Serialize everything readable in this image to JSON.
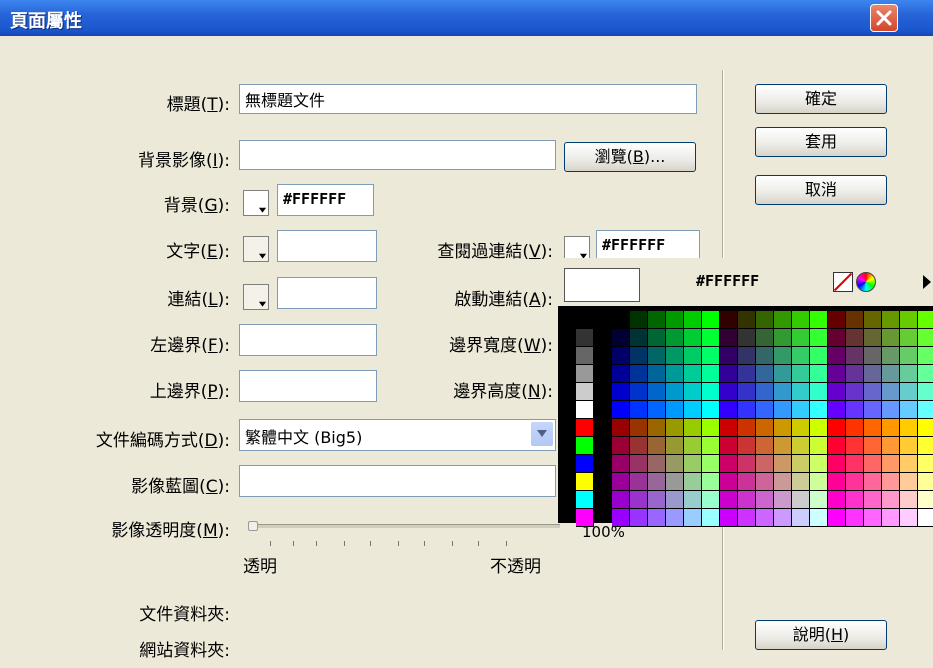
{
  "window": {
    "title": "頁面屬性"
  },
  "form": {
    "title_label": "標題(",
    "title_key": "T",
    "title_end": "):",
    "title_value": "無標題文件",
    "bgimage_label": "背景影像(",
    "bgimage_key": "I",
    "bgimage_end": "):",
    "bgimage_value": "",
    "browse_label": "瀏覽(",
    "browse_key": "B",
    "browse_end": ")...",
    "background_label": "背景(",
    "background_key": "G",
    "background_end": "):",
    "background_value": "#FFFFFF",
    "text_label": "文字(",
    "text_key": "E",
    "text_end": "):",
    "text_value": "",
    "visited_label": "查閱過連結(",
    "visited_key": "V",
    "visited_end": "):",
    "visited_value": "#FFFFFF",
    "links_label": "連結(",
    "links_key": "L",
    "links_end": "):",
    "links_value": "",
    "active_label": "啟動連結(",
    "active_key": "A",
    "active_end": "):",
    "left_margin_label": "左邊界(",
    "left_margin_key": "F",
    "left_margin_end": "):",
    "left_margin_value": "",
    "margin_width_label": "邊界寬度(",
    "margin_width_key": "W",
    "margin_width_end": "):",
    "top_margin_label": "上邊界(",
    "top_margin_key": "P",
    "top_margin_end": "):",
    "top_margin_value": "",
    "margin_height_label": "邊界高度(",
    "margin_height_key": "N",
    "margin_height_end": "):",
    "encoding_label": "文件編碼方式(",
    "encoding_key": "D",
    "encoding_end": "):",
    "encoding_value": "繁體中文 (Big5)",
    "tracing_label": "影像藍圖(",
    "tracing_key": "C",
    "tracing_end": "):",
    "tracing_value": "",
    "opacity_label": "影像透明度(",
    "opacity_key": "M",
    "opacity_end": "):",
    "opacity_min_label": "透明",
    "opacity_max_label": "不透明",
    "opacity_percent": "100%",
    "document_folder_label": "文件資料夾:",
    "site_folder_label": "網站資料夾:"
  },
  "buttons": {
    "ok": "確定",
    "apply": "套用",
    "cancel": "取消",
    "help_label": "說明(",
    "help_key": "H",
    "help_end": ")"
  },
  "color_picker": {
    "selected_hex": "#FFFFFF",
    "icons": [
      "no-color-icon",
      "color-wheel-icon",
      "menu-arrow-icon"
    ]
  },
  "colors": {
    "titlebar": "#2764d8",
    "dialog_bg": "#ece9d8",
    "close_button": "#d2452b"
  }
}
